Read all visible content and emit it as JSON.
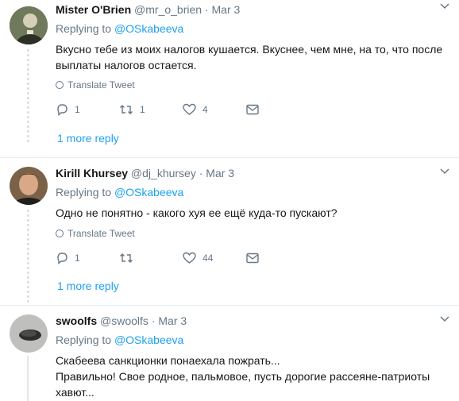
{
  "tweets": [
    {
      "name": "Mister O'Brien",
      "handle": "@mr_o_brien",
      "time": "· Mar 3",
      "replying_prefix": "Replying to",
      "replying_to": "@OSkabeeva",
      "body": [
        "Вкусно тебе из моих налогов кушается. Вкуснее, чем мне, на то, что после",
        "выплаты налогов остается."
      ],
      "translate": "Translate Tweet",
      "reply_count": "1",
      "retweet_count": "1",
      "like_count": "4",
      "more_reply": "1 more reply"
    },
    {
      "name": "Kirill Khursey",
      "handle": "@dj_khursey",
      "time": "· Mar 3",
      "replying_prefix": "Replying to",
      "replying_to": "@OSkabeeva",
      "body": [
        "Одно не понятно - какого хуя ее ещё куда-то пускают?"
      ],
      "translate": "Translate Tweet",
      "reply_count": "1",
      "retweet_count": "",
      "like_count": "44",
      "more_reply": "1 more reply"
    },
    {
      "name": "swoolfs",
      "handle": "@swoolfs",
      "time": "· Mar 3",
      "replying_prefix": "Replying to",
      "replying_to": "@OSkabeeva",
      "body": [
        "Скабеева санкционки понаехала пожрать...",
        "Правильно! Свое родное, пальмовое, пусть дорогие рассеяне-патриоты",
        "хавют..."
      ]
    }
  ],
  "colors": {
    "accent": "#1da1f2",
    "muted": "#657786",
    "text": "#14171a",
    "divider": "#e6ecf0"
  },
  "icons": [
    "caret-down-icon",
    "globe-icon",
    "reply-icon",
    "retweet-icon",
    "heart-icon",
    "direct-message-icon"
  ]
}
